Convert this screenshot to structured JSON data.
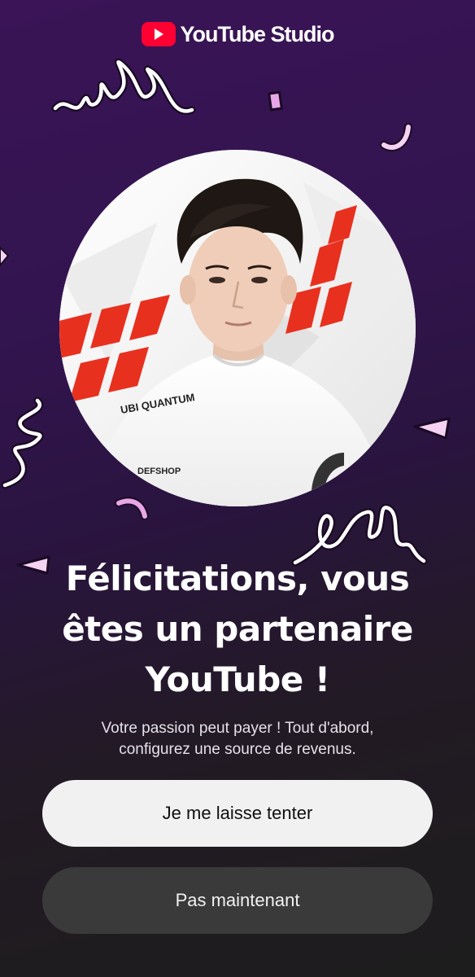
{
  "header": {
    "brand": "YouTube Studio",
    "logo_icon": "youtube-play-icon"
  },
  "avatar": {
    "shirt_text_1": "UBI QUANTUM",
    "shirt_text_2": "DEFSHOP"
  },
  "main": {
    "title_line_1": "Félicitations, vous",
    "title_line_2": "êtes un partenaire",
    "title_line_3": "YouTube !",
    "subtitle_line_1": "Votre passion peut payer ! Tout d'abord,",
    "subtitle_line_2": "configurez une source de revenus."
  },
  "actions": {
    "primary_label": "Je me laisse tenter",
    "secondary_label": "Pas maintenant"
  },
  "colors": {
    "brand_red": "#ff0033",
    "confetti_pink": "#e9a6e6",
    "background_top": "#3a1456",
    "background_bottom": "#1d1d1d"
  }
}
